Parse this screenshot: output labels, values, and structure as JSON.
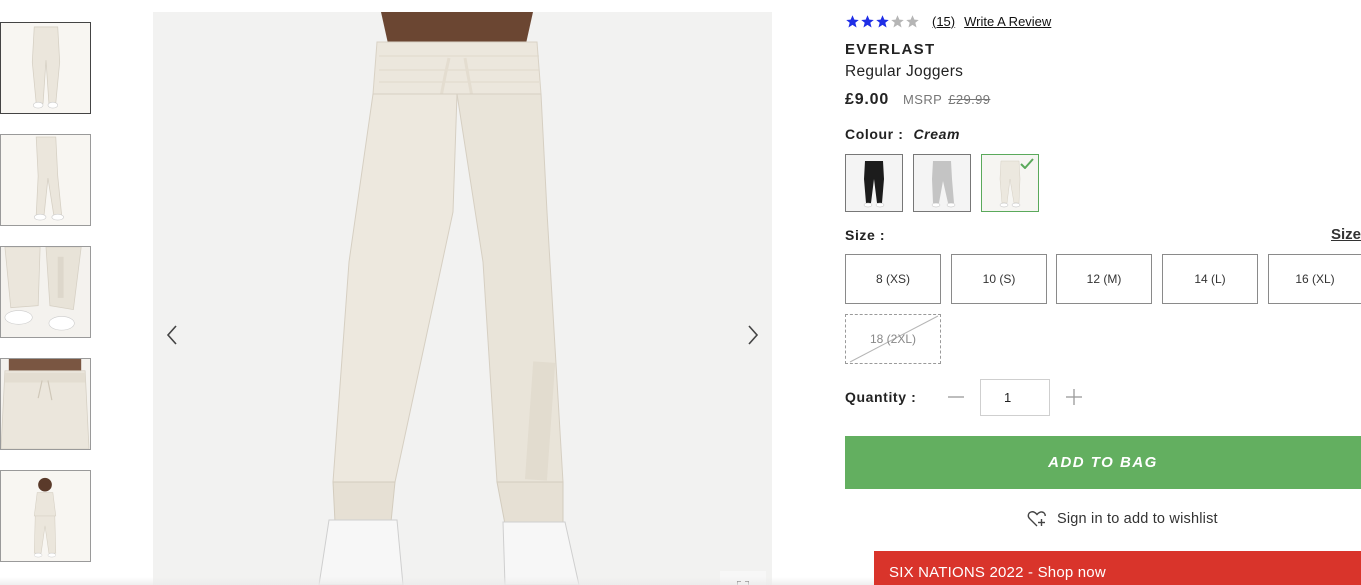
{
  "gallery": {
    "thumbnails": [
      {
        "name": "thumb-front-full",
        "active": true
      },
      {
        "name": "thumb-side-full",
        "active": false
      },
      {
        "name": "thumb-leg-detail",
        "active": false
      },
      {
        "name": "thumb-waist-detail",
        "active": false
      },
      {
        "name": "thumb-model-full",
        "active": false
      }
    ],
    "prev_icon": "chevron-left-icon",
    "next_icon": "chevron-right-icon",
    "zoom_icon": "expand-icon"
  },
  "product": {
    "rating": {
      "value": 3,
      "max": 5,
      "count_label": "(15)",
      "write_review_label": "Write A Review",
      "star_color": "#1f2ee6",
      "empty_star_color": "#b5b5b5"
    },
    "brand": "EVERLAST",
    "name": "Regular Joggers",
    "price": "£9.00",
    "msrp_label": "MSRP",
    "msrp_value": "£29.99",
    "colour_label": "Colour :",
    "colour_value": "Cream",
    "swatches": [
      {
        "name": "Black",
        "color": "#1c1c1c",
        "selected": false
      },
      {
        "name": "Grey",
        "color": "#c4c4c4",
        "selected": false
      },
      {
        "name": "Cream",
        "color": "#ece8df",
        "selected": true
      }
    ],
    "size_label": "Size :",
    "size_guide_label": "Size",
    "sizes": [
      {
        "label": "8 (XS)",
        "available": true
      },
      {
        "label": "10 (S)",
        "available": true
      },
      {
        "label": "12 (M)",
        "available": true
      },
      {
        "label": "14 (L)",
        "available": true
      },
      {
        "label": "16 (XL)",
        "available": true
      },
      {
        "label": "18 (2XL)",
        "available": false
      }
    ],
    "quantity_label": "Quantity :",
    "quantity_value": "1",
    "add_to_bag_label": "ADD TO BAG",
    "add_to_bag_color": "#63af60",
    "wishlist_label": "Sign in to add to wishlist",
    "wishlist_icon": "heart-plus-icon"
  },
  "promo": {
    "label": "SIX NATIONS 2022 - Shop now",
    "color": "#d9342b"
  }
}
